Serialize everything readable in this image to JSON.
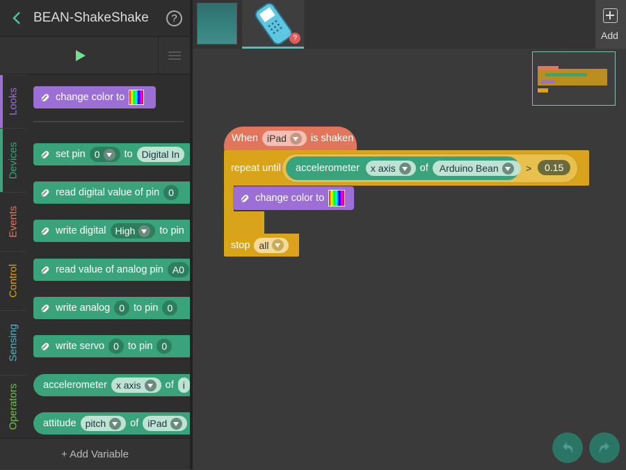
{
  "header": {
    "title": "BEAN-ShakeShake",
    "back_icon": "chevron-left-icon",
    "help_label": "?"
  },
  "categories": [
    {
      "label": "Looks",
      "color": "#9b6fd6"
    },
    {
      "label": "Devices",
      "color": "#3aa37b"
    },
    {
      "label": "Events",
      "color": "#e1765c"
    },
    {
      "label": "Control",
      "color": "#d9a31a"
    },
    {
      "label": "Sensing",
      "color": "#4fb3c5"
    },
    {
      "label": "Operators",
      "color": "#6cc04a"
    }
  ],
  "palette": {
    "change_color": "change color to",
    "set_pin": {
      "label": "set pin",
      "pin": "0",
      "to": "to",
      "mode": "Digital In"
    },
    "read_digital": {
      "label": "read digital value of pin",
      "pin": "0"
    },
    "write_digital": {
      "label": "write digital",
      "value": "High",
      "to": "to pin"
    },
    "read_analog": {
      "label": "read value of analog pin",
      "pin": "A0"
    },
    "write_analog": {
      "label": "write analog",
      "value": "0",
      "to": "to pin",
      "pin": "0"
    },
    "write_servo": {
      "label": "write servo",
      "value": "0",
      "to": "to pin",
      "pin": "0"
    },
    "accelerometer": {
      "label": "accelerometer",
      "axis": "x axis",
      "of": "of",
      "device": "i"
    },
    "attitude": {
      "label": "attitude",
      "axis": "pitch",
      "of": "of",
      "device": "iPad"
    },
    "add_variable": "+ Add Variable"
  },
  "toolbar": {
    "add_label": "Add",
    "badge": "?"
  },
  "script": {
    "when": "When",
    "device": "iPad",
    "event": "is shaken",
    "repeat_until": "repeat until",
    "accel": "accelerometer",
    "axis": "x axis",
    "of": "of",
    "target": "Arduino Bean",
    "op": ">",
    "threshold": "0.15",
    "change_color": "change color to",
    "stop": "stop",
    "stop_option": "all"
  }
}
